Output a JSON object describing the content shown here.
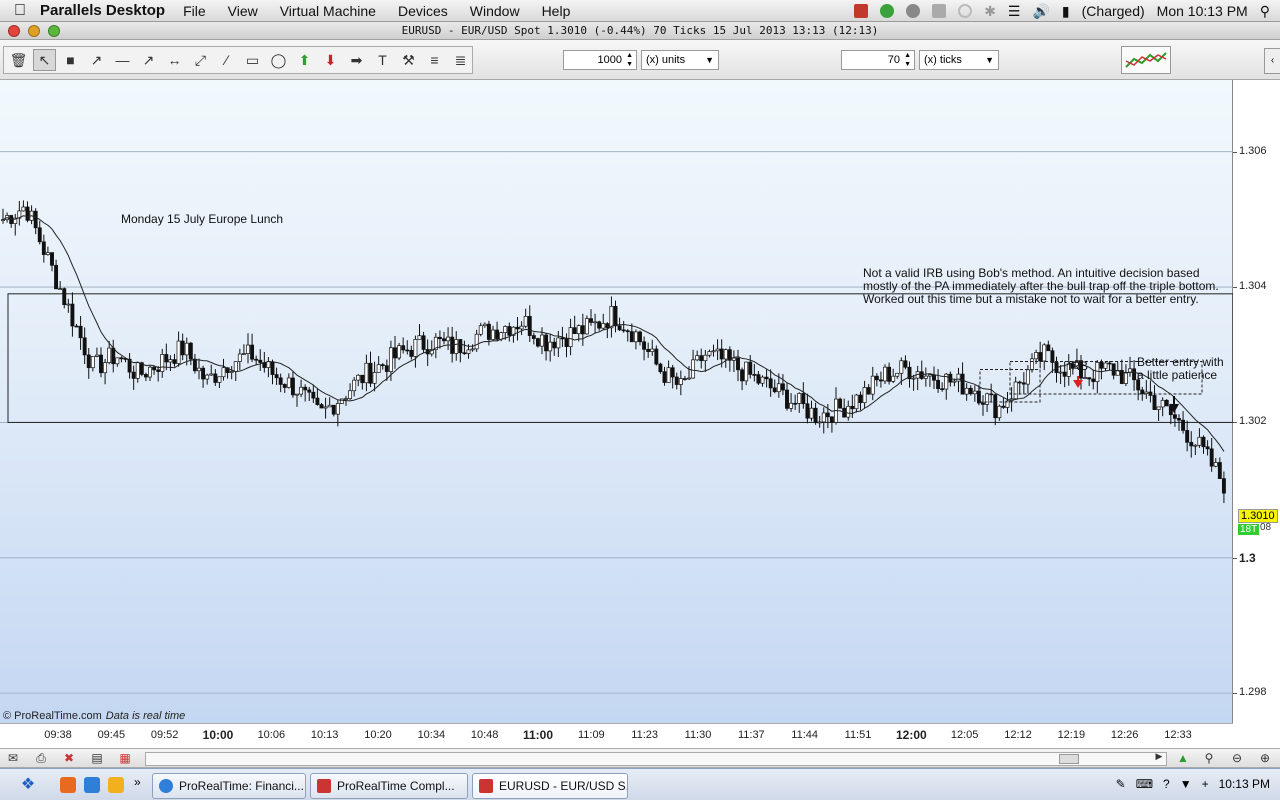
{
  "menubar": {
    "app_name": "Parallels Desktop",
    "menus": [
      "File",
      "View",
      "Virtual Machine",
      "Devices",
      "Window",
      "Help"
    ],
    "battery_status": "(Charged)",
    "clock": "Mon 10:13 PM"
  },
  "window": {
    "title": "EURUSD - EUR/USD Spot    1.3010 (-0.44%)    70 Ticks  15 Jul 2013 13:13 (12:13)"
  },
  "toolbar": {
    "units_value": "1000",
    "units_select": "(x) units",
    "ticks_value": "70",
    "ticks_select": "(x) ticks"
  },
  "chart": {
    "annotation_title": "Monday 15 July Europe Lunch",
    "annotation_note": "Not a valid IRB using Bob's method. An intuitive decision based\nmostly of the PA immediately after the bull trap off the triple bottom.\nWorked out this time but a mistake not to wait for a better entry.",
    "irb_label": "IRB",
    "better_entry_label": "Better entry with\na little patience",
    "copyright": "© ProRealTime.com",
    "realtime_note": "Data is real time",
    "last_price": "1.3010",
    "ticks_tag": "18T",
    "secondary_tag": "08",
    "colors": {
      "irb_arrow": "#e02020",
      "entry_arrow": "#111111",
      "last_price_bg": "#f5f500",
      "ticks_bg": "#33cc33"
    }
  },
  "chart_data": {
    "type": "candlestick",
    "symbol": "EURUSD",
    "y_ticks": [
      "1.306",
      "1.304",
      "1.302",
      "1.3",
      "1.298"
    ],
    "y_values": [
      1.306,
      1.304,
      1.302,
      1.3,
      1.298
    ],
    "ylim": [
      1.2975,
      1.307
    ],
    "x_ticks": [
      "09:38",
      "09:45",
      "09:52",
      "10:00",
      "10:06",
      "10:13",
      "10:20",
      "10:34",
      "10:48",
      "11:00",
      "11:09",
      "11:23",
      "11:30",
      "11:37",
      "11:44",
      "11:51",
      "12:00",
      "12:05",
      "12:12",
      "12:19",
      "12:26",
      "12:33"
    ],
    "x_major": [
      "10:00",
      "11:00",
      "12:00"
    ],
    "close_path": [
      1.305,
      1.3052,
      1.3044,
      1.3036,
      1.3028,
      1.303,
      1.3027,
      1.3029,
      1.3031,
      1.3026,
      1.3029,
      1.303,
      1.3027,
      1.3025,
      1.3021,
      1.3024,
      1.3027,
      1.3029,
      1.3031,
      1.3032,
      1.3031,
      1.3033,
      1.3034,
      1.3035,
      1.3032,
      1.3033,
      1.3034,
      1.3036,
      1.3033,
      1.3028,
      1.3025,
      1.303,
      1.3029,
      1.3027,
      1.3025,
      1.3023,
      1.3021,
      1.3022,
      1.3024,
      1.3027,
      1.3028,
      1.3027,
      1.3026,
      1.3025,
      1.3022,
      1.3026,
      1.303,
      1.3028,
      1.3027,
      1.3028,
      1.3026,
      1.3023,
      1.302,
      1.3016,
      1.3011
    ],
    "range_box": [
      1.302,
      1.3039
    ],
    "last_price": 1.301,
    "grid": true
  }
}
